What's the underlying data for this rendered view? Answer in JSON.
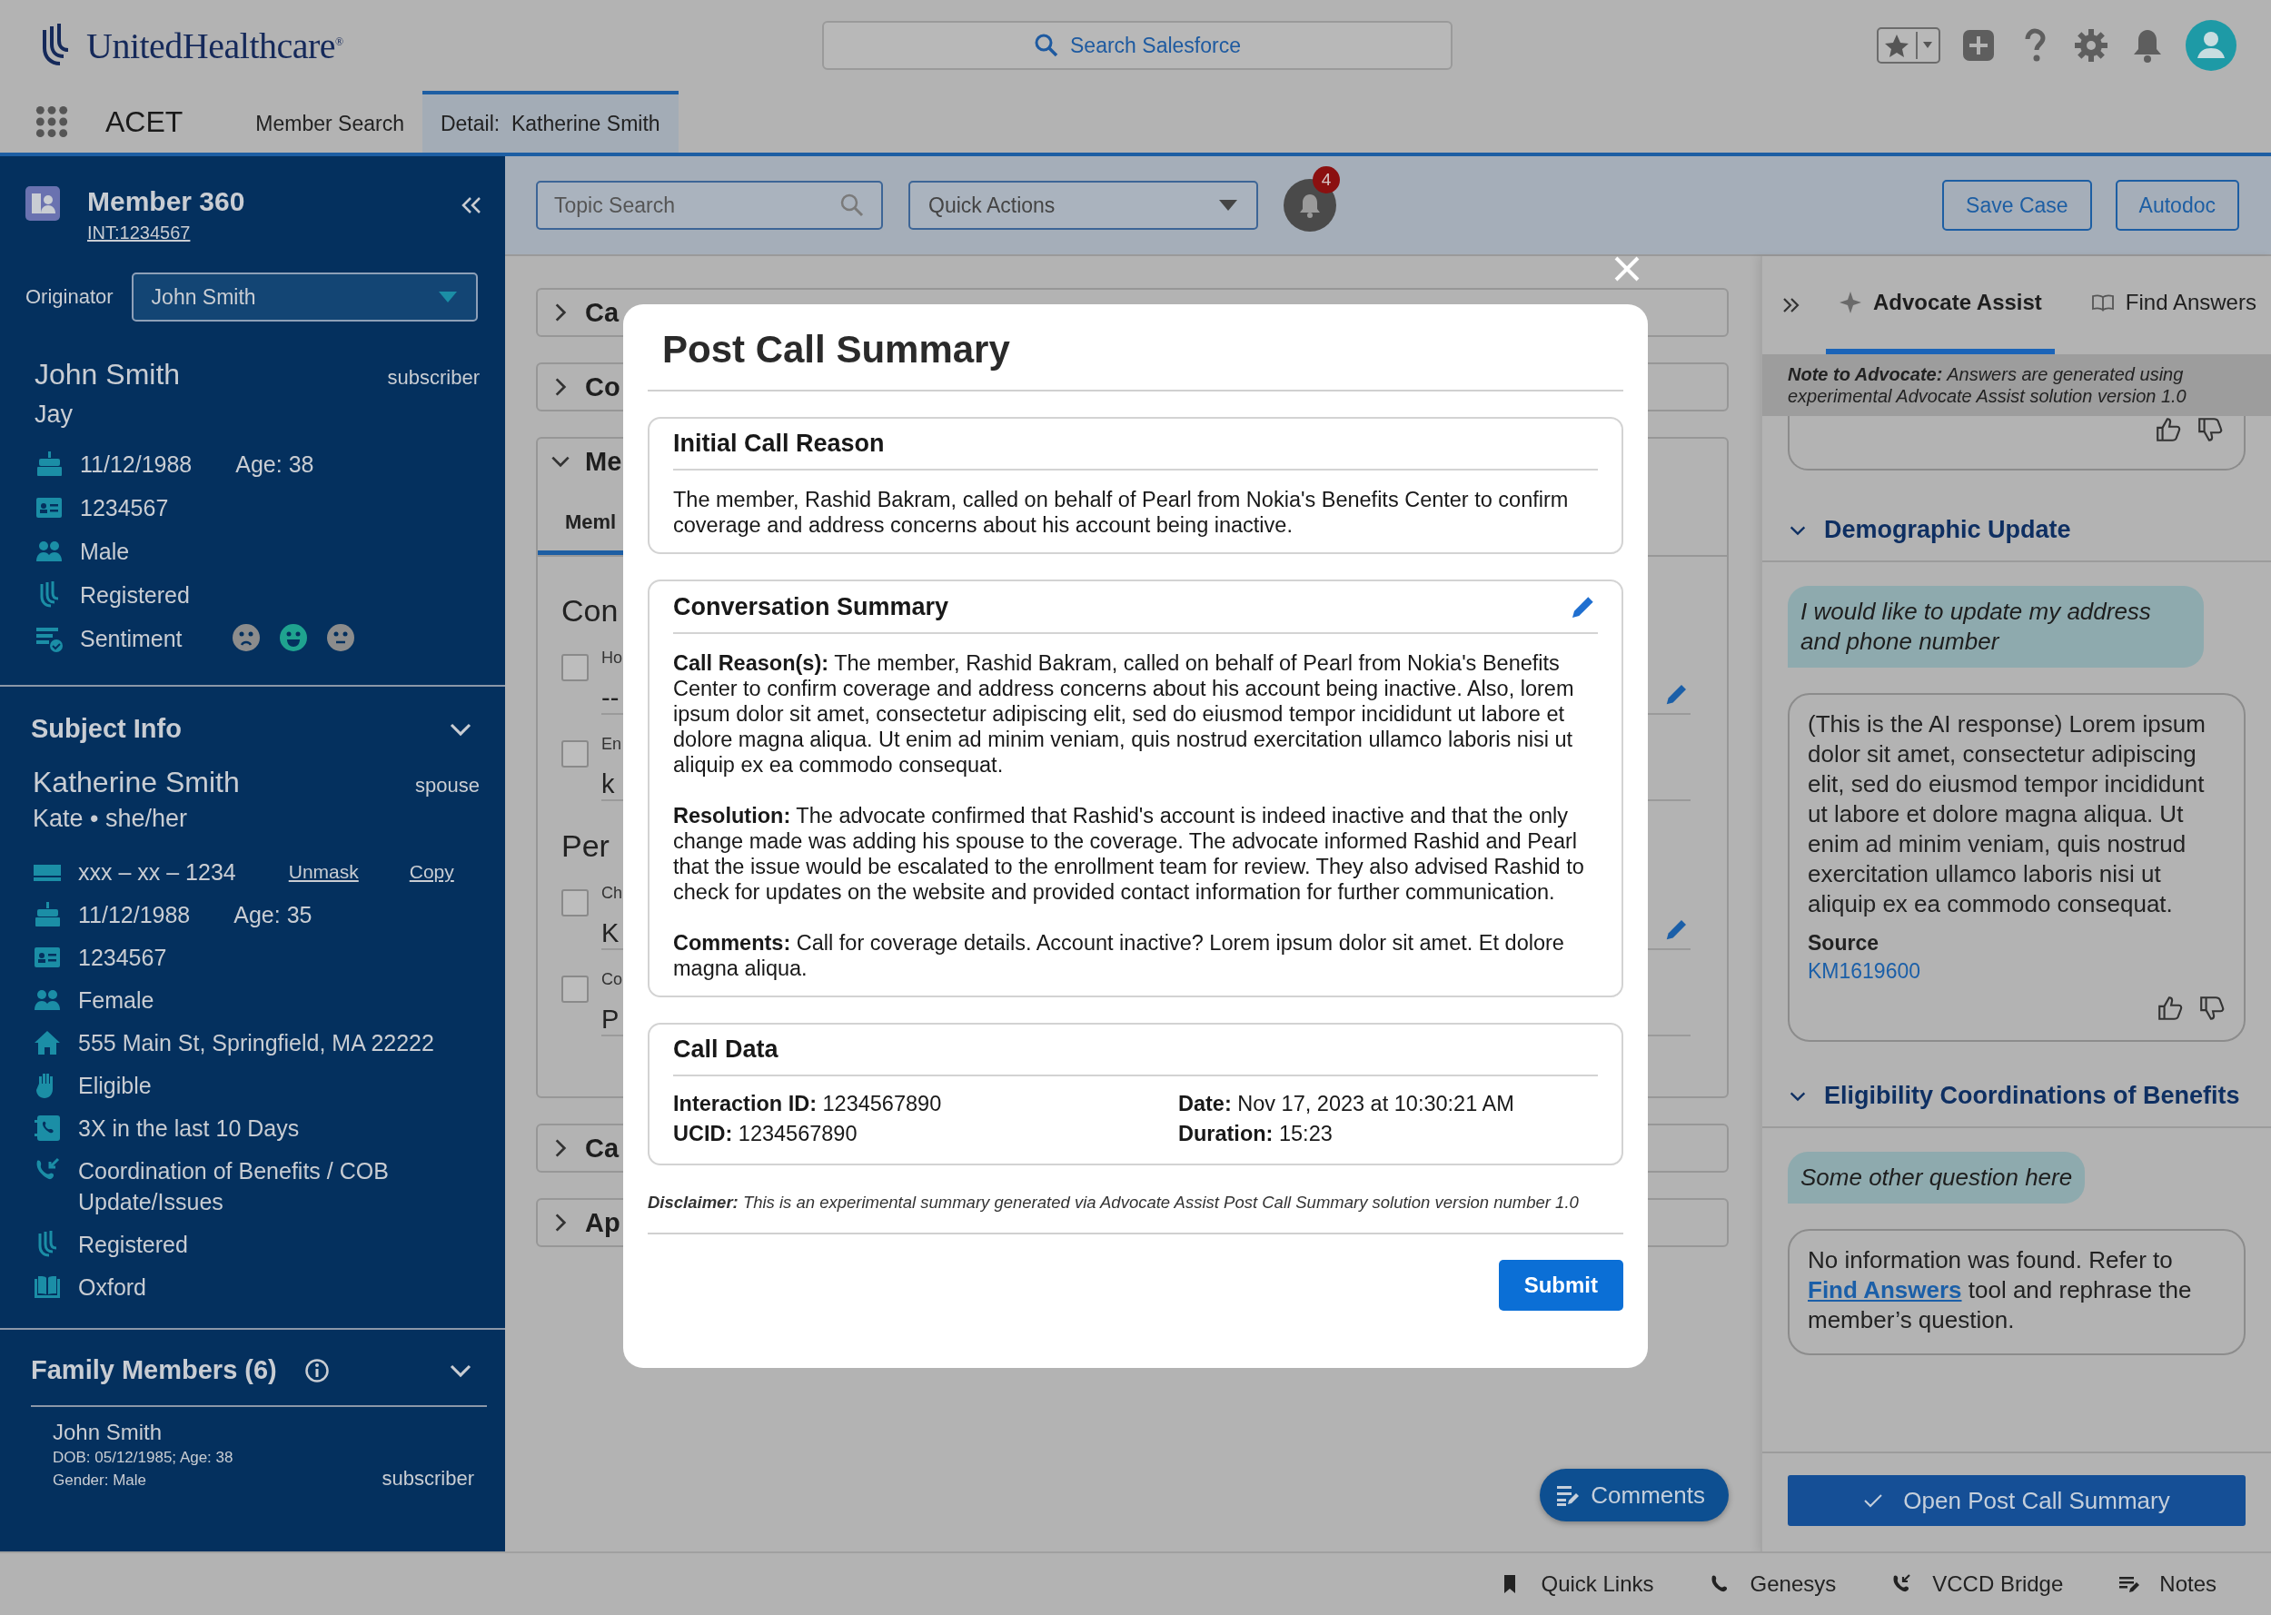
{
  "header": {
    "logo": "UnitedHealthcare$^{®}$",
    "search": {
      "placeholder": "Search Salesforce"
    }
  },
  "nav": {
    "app": "ACET",
    "tabs": [
      {
        "label": "Member Search",
        "selected": false
      },
      {
        "label": "Detail:  Katherine Smith",
        "selected": true
      }
    ]
  },
  "sidebar": {
    "title": "Member 360",
    "id": "INT:1234567",
    "originator": {
      "label": "Originator",
      "value": "John Smith"
    },
    "caller": {
      "name": "John Smith",
      "role": "subscriber",
      "nickname": "Jay",
      "rows": [
        {
          "kind": "birthday",
          "text": "11/12/1988",
          "extra": "Age: 38"
        },
        {
          "kind": "id",
          "text": "1234567"
        },
        {
          "kind": "gender",
          "text": "Male"
        },
        {
          "kind": "registered",
          "text": "Registered"
        }
      ],
      "sentiment": {
        "label": "Sentiment",
        "faces": [
          {
            "kind": "sad",
            "selected": false
          },
          {
            "kind": "happy",
            "selected": true
          },
          {
            "kind": "neutral",
            "selected": false
          }
        ]
      }
    },
    "subject": {
      "heading": "Subject Info",
      "expanded": true,
      "name": "Katherine Smith",
      "role": "spouse",
      "subtitle": "Kate • she/her",
      "rows": [
        {
          "kind": "ssn",
          "text": "xxx – xx – 1234",
          "links": [
            "Unmask",
            "Copy"
          ]
        },
        {
          "kind": "birthday",
          "text": "11/12/1988",
          "extra": "Age: 35"
        },
        {
          "kind": "id",
          "text": "1234567"
        },
        {
          "kind": "gender",
          "text": "Female"
        },
        {
          "kind": "home",
          "text": "555 Main St, Springfield, MA 22222"
        },
        {
          "kind": "eligible",
          "text": "Eligible"
        },
        {
          "kind": "calls",
          "text": "3X in the last 10 Days"
        },
        {
          "kind": "cob",
          "text": "Coordination of Benefits / COB Update/Issues"
        },
        {
          "kind": "registered",
          "text": "Registered"
        },
        {
          "kind": "plan",
          "text": "Oxford"
        }
      ]
    },
    "family": {
      "heading": "Family Members (6)",
      "expanded": true,
      "members": [
        {
          "name": "John Smith",
          "dob": "DOB: 05/12/1985; Age: 38",
          "gender": "Gender: Male",
          "role": "subscriber"
        }
      ]
    }
  },
  "toolbar": {
    "topic_search": {
      "placeholder": "Topic Search"
    },
    "quick_actions": "Quick Actions",
    "notification_count": "4",
    "buttons": [
      "Save Case",
      "Autodoc"
    ]
  },
  "cards": [
    {
      "title": "Ca",
      "expanded": false
    },
    {
      "title": "Co",
      "expanded": false
    },
    {
      "title": "Me",
      "expanded": true,
      "tab": "Meml",
      "groups": [
        {
          "heading": "Con",
          "fields": [
            {
              "label": "Ho",
              "value": "--",
              "checked": false,
              "editable": true
            },
            {
              "label": "En",
              "value": "k",
              "checked": false,
              "editable": false
            }
          ]
        },
        {
          "heading": "Per",
          "fields": [
            {
              "label": "Ch",
              "value": "K",
              "checked": false,
              "editable": true
            },
            {
              "label": "Co",
              "value": "P",
              "checked": false,
              "editable": false
            }
          ]
        }
      ]
    },
    {
      "title": "Ca",
      "expanded": false
    },
    {
      "title": "Ap",
      "expanded": false
    }
  ],
  "comments_button": "Comments",
  "modal": {
    "title": "Post Call Summary",
    "sections": [
      {
        "kind": "text",
        "title": "Initial Call Reason",
        "editable": false,
        "paragraphs": [
          "The member, Rashid Bakram, called on behalf of Pearl from Nokia's Benefits Center to confirm coverage and address concerns about his account being inactive."
        ]
      },
      {
        "kind": "text",
        "title": "Conversation Summary",
        "editable": true,
        "paragraphs": [
          "**Call Reason(s):** The member, Rashid Bakram, called on behalf of Pearl from Nokia's Benefits Center to confirm coverage and address concerns about his account being inactive. Also, lorem ipsum dolor sit amet, consectetur adipiscing elit, sed do eiusmod tempor incididunt ut labore et dolore magna aliqua. Ut enim ad minim veniam, quis nostrud exercitation ullamco laboris nisi ut aliquip ex ea commodo consequat.",
          "**Resolution:** The advocate confirmed that Rashid's account is indeed inactive and that the only change made was adding his spouse to the coverage. The advocate informed Rashid and Pearl that the issue would be escalated to the enrollment team for review. They also advised Rashid to check for updates on the website and provided contact information for further communication.",
          "**Comments:** Call for coverage details. Account inactive? Lorem ipsum dolor sit amet. Et dolore magna aliqua."
        ]
      },
      {
        "kind": "fields",
        "title": "Call Data",
        "editable": false,
        "fields": [
          "**Interaction ID:** 1234567890",
          "**Date:** Nov 17, 2023 at 10:30:21 AM",
          "**UCID:** 1234567890",
          "**Duration:** 15:23"
        ]
      }
    ],
    "disclaimer": "**Disclaimer:** This is an experimental summary generated via Advocate Assist Post Call Summary solution version number 1.0",
    "submit": "Submit"
  },
  "assist": {
    "tabs": [
      {
        "kind": "sparkle",
        "label": "Advocate Assist",
        "selected": true
      },
      {
        "kind": "book",
        "label": "Find Answers",
        "selected": false
      }
    ],
    "note": "**Note to Advocate:** Answers are generated using experimental Advocate Assist solution version 1.0",
    "topics": [
      {
        "title": "Demographic Update",
        "expanded": true,
        "question": "I would like to update my address and phone number",
        "answer": "(This is the AI response) Lorem ipsum dolor sit amet, consectetur adipiscing elit, sed do eiusmod tempor incididunt ut labore et dolore magna aliqua. Ut enim ad minim veniam, quis nostrud exercitation ullamco laboris nisi ut aliquip ex ea commodo consequat.",
        "source_label": "Source",
        "source": "KM1619600"
      },
      {
        "title": "Eligibility Coordinations of Benefits",
        "expanded": true,
        "question": "Some other question here",
        "answer_before": "No information was found. Refer to",
        "answer_link": "Find Answers",
        "answer_after": "tool and rephrase the member’s question."
      }
    ],
    "action": "Open Post Call Summary"
  },
  "utility_bar": [
    {
      "kind": "bookmark",
      "label": "Quick Links"
    },
    {
      "kind": "phone",
      "label": "Genesys"
    },
    {
      "kind": "incoming",
      "label": "VCCD Bridge"
    },
    {
      "kind": "notes",
      "label": "Notes"
    }
  ]
}
